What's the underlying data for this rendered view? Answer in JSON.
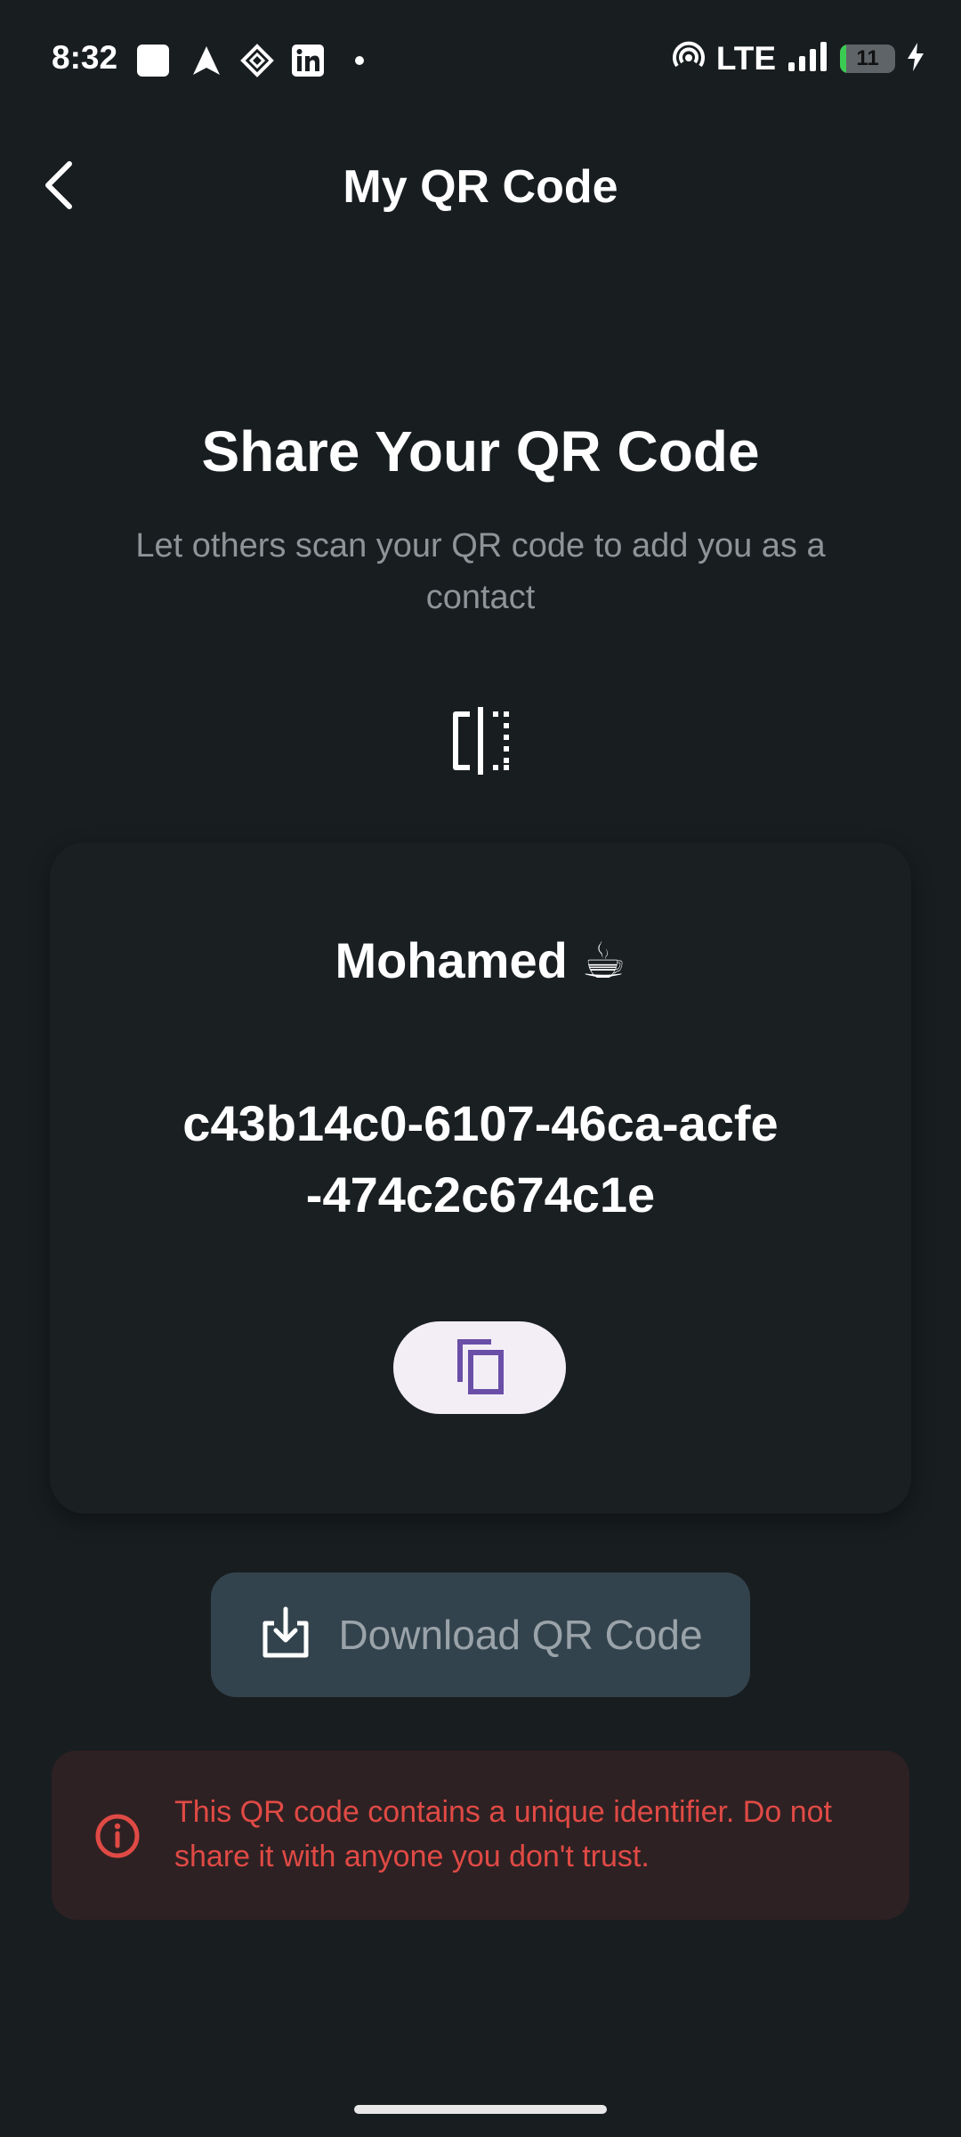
{
  "status_bar": {
    "time": "8:32",
    "network": "LTE",
    "battery_level": "11",
    "notification_icons": [
      "square-icon",
      "navigation-arrow-icon",
      "tiktok-like-icon",
      "linkedin-icon",
      "dot-icon"
    ],
    "right_icons": [
      "hotspot-icon",
      "signal-icon",
      "battery-icon",
      "charging-bolt-icon"
    ]
  },
  "app_bar": {
    "title": "My QR Code",
    "back_icon": "chevron-left-icon"
  },
  "header": {
    "title": "Share Your QR Code",
    "subtitle": "Let others scan your QR code to add you as a contact",
    "icon": "flip-mirror-icon"
  },
  "card": {
    "name": "Mohamed ☕",
    "id": "c43b14c0-6107-46ca-acfe-474c2c674c1e",
    "copy_icon": "copy-icon"
  },
  "download": {
    "label": "Download QR Code",
    "icon": "download-icon"
  },
  "warning": {
    "text": "This QR code contains a unique identifier. Do not share it with anyone you don't trust.",
    "icon": "info-circle-icon"
  },
  "colors": {
    "background": "#181d20",
    "card": "#1a1f22",
    "copy_button": "#f3eef6",
    "copy_icon": "#6a4fa8",
    "download_button": "#33434d",
    "warning_bg": "#2e2123",
    "warning_text": "#e04a45"
  }
}
